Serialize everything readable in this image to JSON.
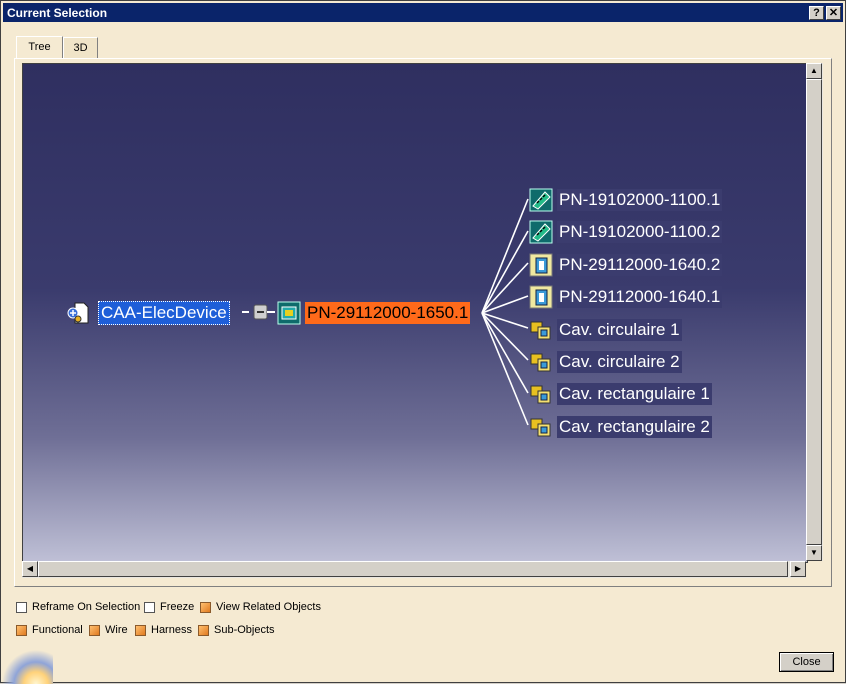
{
  "window": {
    "title": "Current Selection",
    "help_label": "?",
    "close_label": "✕"
  },
  "tabs": [
    {
      "label": "Tree",
      "active": true
    },
    {
      "label": "3D",
      "active": false
    }
  ],
  "tree": {
    "root": {
      "label": "CAA-ElecDevice",
      "icon": "electrical-device-icon"
    },
    "selected": {
      "label": "PN-29112000-1650.1",
      "icon": "connector-part-icon"
    },
    "children": [
      {
        "label": "PN-19102000-1100.1",
        "icon": "connector-icon"
      },
      {
        "label": "PN-19102000-1100.2",
        "icon": "connector-icon"
      },
      {
        "label": "PN-29112000-1640.2",
        "icon": "contact-part-icon"
      },
      {
        "label": "PN-29112000-1640.1",
        "icon": "contact-part-icon"
      },
      {
        "label": "Cav. circulaire 1",
        "icon": "cavity-icon"
      },
      {
        "label": "Cav. circulaire 2",
        "icon": "cavity-icon"
      },
      {
        "label": "Cav. rectangulaire 1",
        "icon": "cavity-icon"
      },
      {
        "label": "Cav. rectangulaire 2",
        "icon": "cavity-icon"
      }
    ]
  },
  "options": {
    "reframe": {
      "label": "Reframe On Selection",
      "checked": false
    },
    "freeze": {
      "label": "Freeze",
      "checked": false
    },
    "view_related": {
      "label": "View Related Objects",
      "checked": true
    },
    "functional": {
      "label": "Functional",
      "checked": true
    },
    "wire": {
      "label": "Wire",
      "checked": true
    },
    "harness": {
      "label": "Harness",
      "checked": true
    },
    "sub_objects": {
      "label": "Sub-Objects",
      "checked": true
    }
  },
  "buttons": {
    "close": "Close"
  },
  "colors": {
    "titlebar": "#0a246a",
    "selection": "#1e5ed8",
    "highlight": "#ff6a1a",
    "background_top": "#2f2f60"
  }
}
